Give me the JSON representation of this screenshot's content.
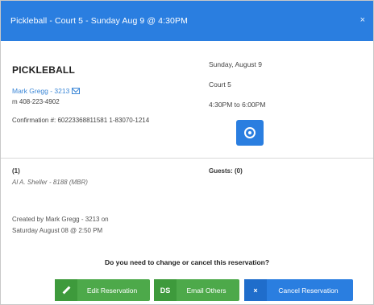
{
  "header": {
    "title": "Pickleball - Court 5 - Sunday Aug 9 @ 4:30PM",
    "close_glyph": "×"
  },
  "reservation": {
    "title": "PICKLEBALL",
    "member_name": "Mark Gregg - 3213",
    "phone": "m 408-223-4902",
    "confirmation": "Confirmation #: 60223368811581 1-83070-1214",
    "date": "Sunday, August 9",
    "court": "Court 5",
    "time": "4:30PM to 6:00PM"
  },
  "players": {
    "count_label": "(1)",
    "player_1": "Al A. Sheller - 8188 (MBR)",
    "guests_label": "Guests: (0)"
  },
  "created": {
    "line1": "Created by Mark Gregg - 3213 on",
    "line2": "Saturday August 08 @ 2:50 PM"
  },
  "footer": {
    "question": "Do you need to change or cancel this reservation?",
    "edit_label": "Edit Reservation",
    "email_icon_text": "DS",
    "email_label": "Email Others",
    "cancel_icon_text": "×",
    "cancel_label": "Cancel Reservation"
  },
  "colors": {
    "header_blue": "#2a7ee0",
    "button_green": "#4da94a",
    "link_blue": "#3a86d6"
  },
  "icons": {
    "mail": "mail-icon",
    "lock": "lock-icon",
    "pencil": "pencil-icon",
    "close": "close-icon"
  }
}
